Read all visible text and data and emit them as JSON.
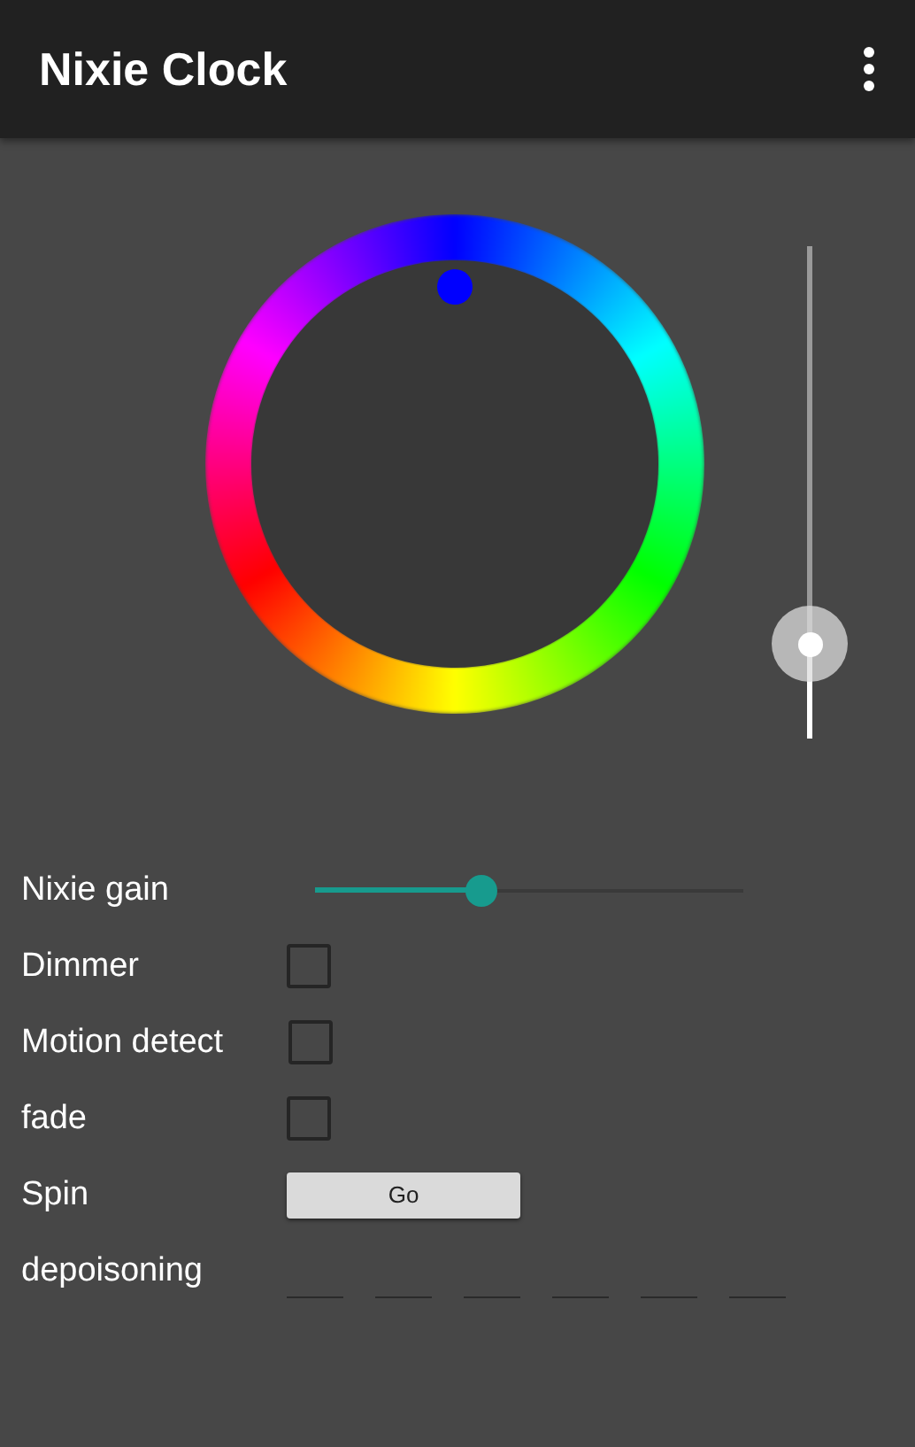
{
  "app_bar": {
    "title": "Nixie Clock"
  },
  "color_picker": {
    "color": "#0000ff"
  },
  "brightness_slider": {
    "level": 0.19
  },
  "settings": [
    {
      "kind": "slider",
      "label": "Nixie gain",
      "level": 0.39
    },
    {
      "kind": "checkbox",
      "label": "Dimmer",
      "checked": false
    },
    {
      "kind": "checkbox",
      "label": "Motion detect",
      "checked": false
    },
    {
      "kind": "checkbox",
      "label": "fade",
      "checked": false
    },
    {
      "kind": "button",
      "label": "Spin",
      "button": "Go"
    },
    {
      "kind": "digits",
      "label": "depoisoning",
      "digits": [
        {
          "filled": false
        },
        {
          "filled": false
        },
        {
          "filled": false
        },
        {
          "filled": false
        },
        {
          "filled": false
        },
        {
          "filled": false
        }
      ]
    }
  ]
}
